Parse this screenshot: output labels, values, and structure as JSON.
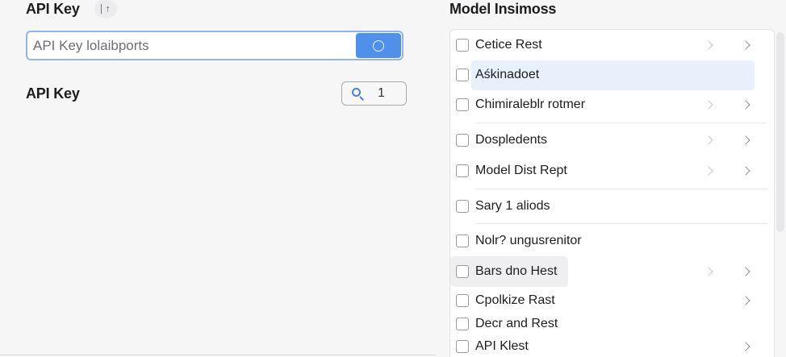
{
  "left": {
    "title": "API Key",
    "title_pill_icon": "arrow-up-icon",
    "title_pill_glyph": "↑",
    "search": {
      "placeholder": "API Key lolaibports",
      "button_icon": "circle-icon"
    },
    "section_label": "API Key",
    "stepper": {
      "icon": "search-icon",
      "value": "1"
    }
  },
  "right": {
    "title": "Model Insimoss",
    "items": [
      {
        "label": "Cetice Rest",
        "checked": false,
        "chevrons": 2
      },
      {
        "label": "Aśkinadoet",
        "checked": false,
        "chevrons": 0,
        "highlight": "selected"
      },
      {
        "label": "Chimiraleblr rotmer",
        "checked": false,
        "chevrons": 2
      },
      {
        "label": "Dospledents",
        "checked": false,
        "chevrons": 2
      },
      {
        "label": "Model Dist Rept",
        "checked": false,
        "chevrons": 2
      },
      {
        "label": "Sary 1 aliods",
        "checked": false,
        "chevrons": 0
      },
      {
        "label": "Nolr? ungusrenitor",
        "checked": false,
        "chevrons": 0
      },
      {
        "label": "Bars dno Hest",
        "checked": false,
        "chevrons": 2,
        "highlight": "hover"
      },
      {
        "label": "Cpolkize Rast",
        "checked": false,
        "chevrons": 1
      },
      {
        "label": "Decr and Rest",
        "checked": false,
        "chevrons": 0
      },
      {
        "label": "API Klest",
        "checked": false,
        "chevrons": 1
      }
    ]
  },
  "colors": {
    "accent": "#4f91ea",
    "focus_border": "#8fb4ef",
    "selection": "#e8f0fc"
  }
}
